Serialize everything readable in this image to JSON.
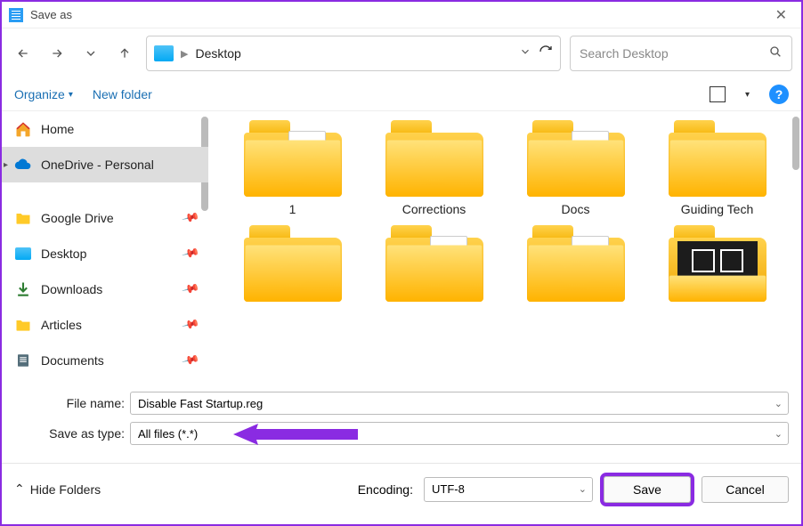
{
  "window": {
    "title": "Save as"
  },
  "nav": {
    "location": "Desktop"
  },
  "search": {
    "placeholder": "Search Desktop"
  },
  "toolbar": {
    "organize": "Organize",
    "newfolder": "New folder"
  },
  "sidebar": {
    "home": "Home",
    "onedrive": "OneDrive - Personal",
    "items": [
      {
        "label": "Google Drive"
      },
      {
        "label": "Desktop"
      },
      {
        "label": "Downloads"
      },
      {
        "label": "Articles"
      },
      {
        "label": "Documents"
      }
    ]
  },
  "tiles": [
    {
      "name": "1"
    },
    {
      "name": "Corrections"
    },
    {
      "name": "Docs"
    },
    {
      "name": "Guiding Tech"
    }
  ],
  "form": {
    "filename_label": "File name:",
    "filename_value": "Disable Fast Startup.reg",
    "saveas_label": "Save as type:",
    "saveas_value": "All files  (*.*)"
  },
  "footer": {
    "hide": "Hide Folders",
    "encoding_label": "Encoding:",
    "encoding_value": "UTF-8",
    "save": "Save",
    "cancel": "Cancel"
  }
}
